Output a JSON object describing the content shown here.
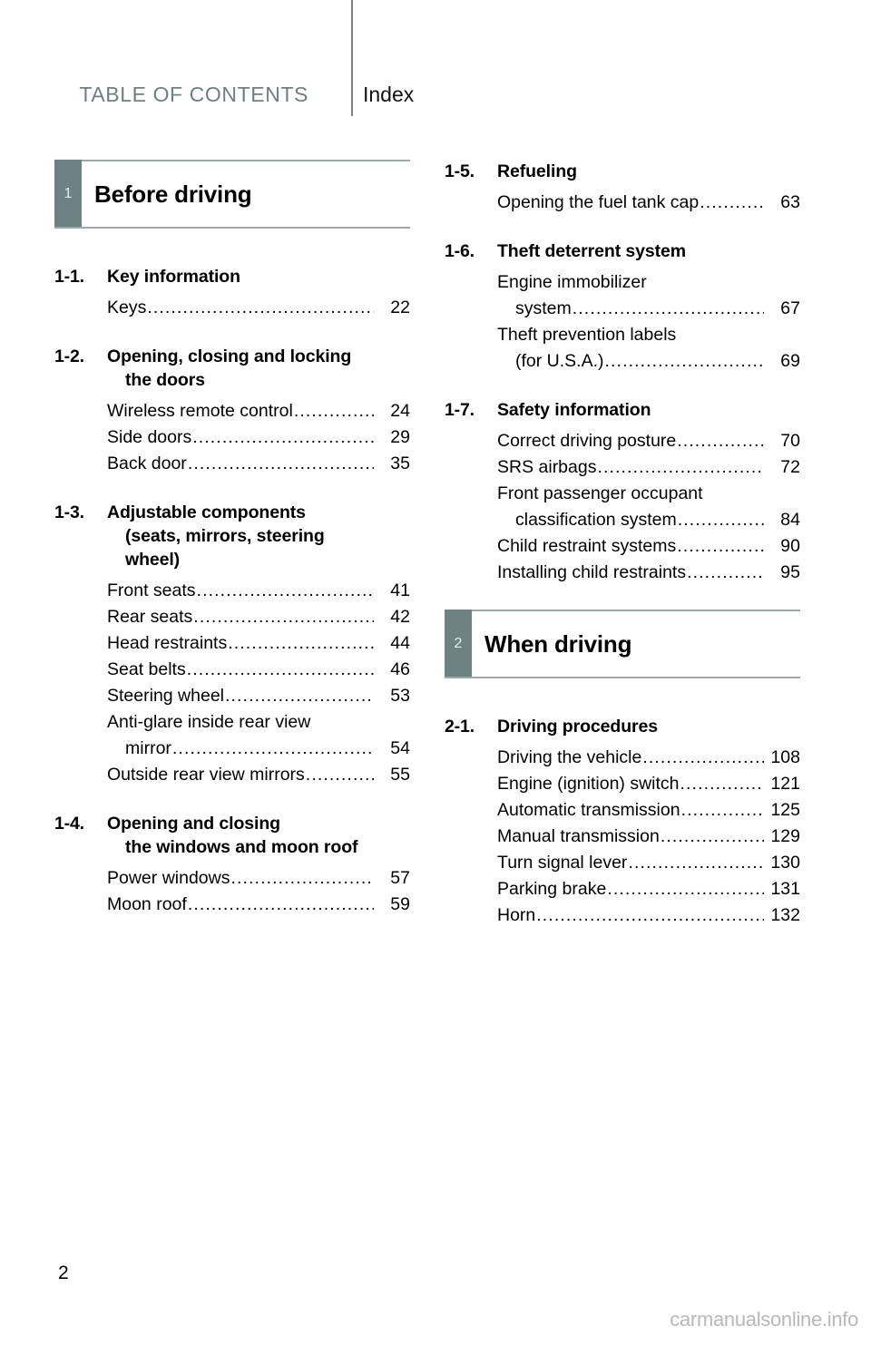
{
  "header": {
    "toc_label": "TABLE OF CONTENTS",
    "index_label": "Index"
  },
  "footer": {
    "page_number": "2",
    "watermark": "carmanualsonline.info"
  },
  "chapters": [
    {
      "number": "1",
      "title": "Before driving",
      "column": "left",
      "sections": [
        {
          "number": "1-1.",
          "title": "Key information",
          "entries": [
            {
              "text": "Keys",
              "page": "22"
            }
          ]
        },
        {
          "number": "1-2.",
          "title": "Opening, closing and locking the doors",
          "title_line1": "Opening, closing and locking",
          "title_line2": "the doors",
          "entries": [
            {
              "text": "Wireless remote control",
              "page": "24"
            },
            {
              "text": "Side doors",
              "page": "29"
            },
            {
              "text": "Back door",
              "page": "35"
            }
          ]
        },
        {
          "number": "1-3.",
          "title": "Adjustable components (seats, mirrors, steering wheel)",
          "title_line1": "Adjustable components",
          "title_line2": "(seats, mirrors, steering",
          "title_line3": "wheel)",
          "entries": [
            {
              "text": "Front seats",
              "page": "41"
            },
            {
              "text": "Rear seats",
              "page": "42"
            },
            {
              "text": "Head restraints",
              "page": "44"
            },
            {
              "text": "Seat belts",
              "page": "46"
            },
            {
              "text": "Steering wheel",
              "page": "53"
            },
            {
              "text_line1": "Anti-glare inside rear view",
              "text_line2": "mirror",
              "page": "54",
              "wrapped": true
            },
            {
              "text": "Outside rear view mirrors",
              "page": "55"
            }
          ]
        },
        {
          "number": "1-4.",
          "title": "Opening and closing the windows and moon roof",
          "title_line1": "Opening and closing",
          "title_line2": "the windows and moon roof",
          "entries": [
            {
              "text": "Power windows",
              "page": "57"
            },
            {
              "text": "Moon roof",
              "page": "59"
            }
          ]
        }
      ]
    },
    {
      "number": "1-right",
      "sections_only": true,
      "column": "right",
      "sections": [
        {
          "number": "1-5.",
          "title": "Refueling",
          "entries": [
            {
              "text": "Opening the fuel tank cap",
              "page": "63"
            }
          ]
        },
        {
          "number": "1-6.",
          "title": "Theft deterrent system",
          "entries": [
            {
              "text_line1": "Engine immobilizer",
              "text_line2": "system",
              "page": "67",
              "wrapped": true
            },
            {
              "text_line1": "Theft prevention labels",
              "text_line2": "(for U.S.A.)",
              "page": "69",
              "wrapped": true
            }
          ]
        },
        {
          "number": "1-7.",
          "title": "Safety information",
          "entries": [
            {
              "text": "Correct driving posture",
              "page": "70"
            },
            {
              "text": "SRS airbags",
              "page": "72"
            },
            {
              "text_line1": "Front passenger occupant",
              "text_line2": "classification system",
              "page": "84",
              "wrapped": true
            },
            {
              "text": "Child restraint systems",
              "page": "90"
            },
            {
              "text": "Installing child restraints",
              "page": "95"
            }
          ]
        }
      ]
    },
    {
      "number": "2",
      "title": "When driving",
      "column": "right",
      "sections": [
        {
          "number": "2-1.",
          "title": "Driving procedures",
          "entries": [
            {
              "text": "Driving the vehicle",
              "page": "108"
            },
            {
              "text": "Engine (ignition) switch",
              "page": "121"
            },
            {
              "text": "Automatic transmission",
              "page": "125"
            },
            {
              "text": "Manual transmission",
              "page": "129"
            },
            {
              "text": "Turn signal lever",
              "page": "130"
            },
            {
              "text": "Parking brake",
              "page": "131"
            },
            {
              "text": "Horn",
              "page": "132"
            }
          ]
        }
      ]
    }
  ],
  "colors": {
    "chapter_box": "#6e8284",
    "rule": "#9aa9aa",
    "toc_header_text": "#6f7f80",
    "watermark": "#b8b8bc"
  }
}
